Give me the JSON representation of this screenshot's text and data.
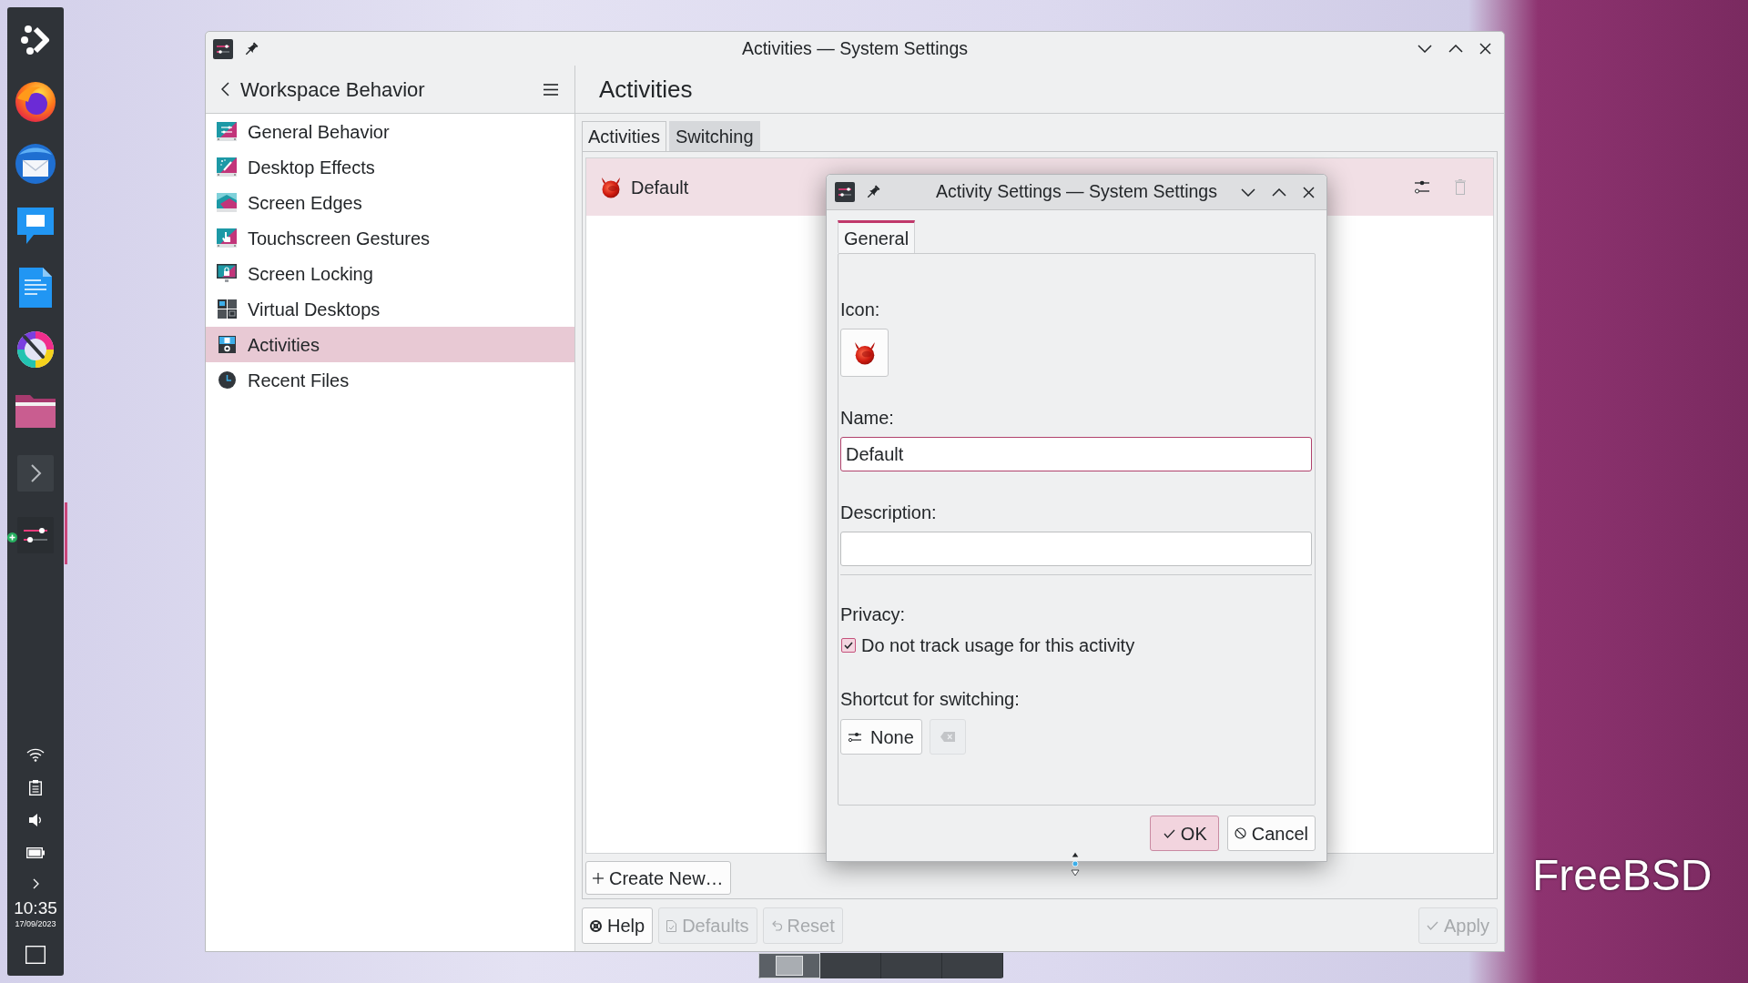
{
  "desktop": {
    "logo_text": "FreeBSD"
  },
  "panel": {
    "tasks": [
      {
        "kind": "launcher",
        "active": false,
        "badge": false
      },
      {
        "kind": "browser",
        "active": false,
        "badge": false
      },
      {
        "kind": "mail",
        "active": false,
        "badge": false
      },
      {
        "kind": "chat",
        "active": false,
        "badge": false
      },
      {
        "kind": "writer",
        "active": false,
        "badge": false
      },
      {
        "kind": "paint",
        "active": false,
        "badge": false
      },
      {
        "kind": "files",
        "active": false,
        "badge": false
      },
      {
        "kind": "terminal",
        "active": false,
        "badge": false
      },
      {
        "kind": "settings",
        "active": true,
        "badge": true
      }
    ],
    "clock": {
      "time": "10:35",
      "date": "17/09/2023"
    }
  },
  "pager": {
    "desktops": [
      {
        "selected": true
      },
      {
        "selected": false
      },
      {
        "selected": false
      },
      {
        "selected": false
      }
    ]
  },
  "main_window": {
    "title": "Activities — System Settings",
    "sidebar": {
      "title": "Workspace Behavior",
      "items": [
        {
          "kind": "general",
          "label": "General Behavior",
          "selected": false
        },
        {
          "kind": "effects",
          "label": "Desktop Effects",
          "selected": false
        },
        {
          "kind": "edges",
          "label": "Screen Edges",
          "selected": false
        },
        {
          "kind": "touch",
          "label": "Touchscreen Gestures",
          "selected": false
        },
        {
          "kind": "lock",
          "label": "Screen Locking",
          "selected": false
        },
        {
          "kind": "desktops",
          "label": "Virtual Desktops",
          "selected": false
        },
        {
          "kind": "activities",
          "label": "Activities",
          "selected": true
        },
        {
          "kind": "recent",
          "label": "Recent Files",
          "selected": false
        }
      ]
    },
    "page": {
      "title": "Activities",
      "tabs": [
        {
          "label": "Activities",
          "selected": true
        },
        {
          "label": "Switching",
          "selected": false
        }
      ],
      "activities": [
        {
          "name": "Default",
          "selected": true,
          "delete_disabled": true
        }
      ],
      "create_button": "Create New…"
    },
    "buttons": [
      {
        "kind": "help",
        "label": "Help",
        "disabled": false
      },
      {
        "kind": "defaults",
        "label": "Defaults",
        "disabled": true
      },
      {
        "kind": "reset",
        "label": "Reset",
        "disabled": true
      },
      {
        "kind": "apply",
        "label": "Apply",
        "disabled": true
      }
    ]
  },
  "dialog": {
    "title": "Activity Settings — System Settings",
    "tabs": [
      {
        "label": "General",
        "selected": true
      }
    ],
    "icon_label": "Icon:",
    "name": {
      "label": "Name:",
      "value": "Default",
      "focused": true
    },
    "description": {
      "label": "Description:"
    },
    "privacy": {
      "label": "Privacy:",
      "checkbox": {
        "label": "Do not track usage for this activity",
        "checked": true
      }
    },
    "shortcut": {
      "label": "Shortcut for switching:",
      "value": "None",
      "clear_disabled": true
    },
    "buttons": [
      {
        "kind": "ok",
        "label": "OK",
        "default": true
      },
      {
        "kind": "cancel",
        "label": "Cancel",
        "default": false
      }
    ]
  }
}
